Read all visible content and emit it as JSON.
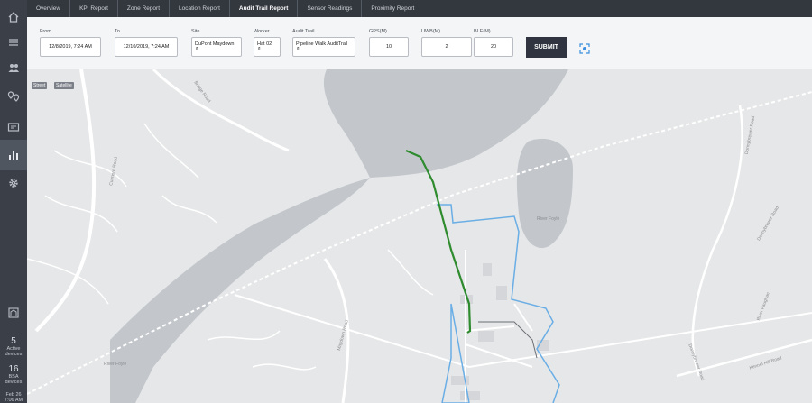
{
  "nav": {
    "tabs": [
      {
        "label": "Overview"
      },
      {
        "label": "KPI Report"
      },
      {
        "label": "Zone Report"
      },
      {
        "label": "Location Report"
      },
      {
        "label": "Audit Trail Report"
      },
      {
        "label": "Sensor Readings"
      },
      {
        "label": "Proximity Report"
      }
    ],
    "active_tab": "Audit Trail Report"
  },
  "filters": {
    "from": {
      "label": "From",
      "value": "12/8/2019, 7:24 AM"
    },
    "to": {
      "label": "To",
      "value": "12/10/2019, 7:24 AM"
    },
    "site": {
      "label": "Site",
      "value": "DuPont Maydown ⇕"
    },
    "worker": {
      "label": "Worker",
      "value": "Hat 02 ⇕"
    },
    "audit_trail": {
      "label": "Audit Trail",
      "value": "Pipeline Walk AuditTrail ⇕"
    },
    "gps": {
      "label": "GPS(M)",
      "value": "10"
    },
    "uwb": {
      "label": "UWB(M)",
      "value": "2"
    },
    "ble": {
      "label": "BLE(M)",
      "value": "20"
    },
    "submit_label": "SUBMIT"
  },
  "map": {
    "type_buttons": [
      "Street",
      "Satellite"
    ],
    "labels": {
      "bridge_road": "Bridge Road",
      "culmore_road": "Culmore Road",
      "maydown_road": "Maydown Road",
      "river_foyle_1": "River Foyle",
      "river_foyle_2": "River Foyle",
      "donnybrewer_1": "Donnybrewer Road",
      "donnybrewer_2": "Donnybrewer Road",
      "donnybrewer_3": "Donnybrewer Road",
      "river_faughan": "River Faughan",
      "kennel_hill": "Kennel Hill Road"
    },
    "colors": {
      "water": "#c3c7cc",
      "land": "#e6e7e8",
      "road": "#ffffff",
      "path": "#2e8b2e",
      "zone": "#6aaee6"
    }
  },
  "sidebar": {
    "stats": [
      {
        "num": "5",
        "text": "Active devices"
      },
      {
        "num": "16",
        "text": "BSA devices"
      }
    ],
    "date": "Feb 26",
    "time": "7:06 AM"
  }
}
